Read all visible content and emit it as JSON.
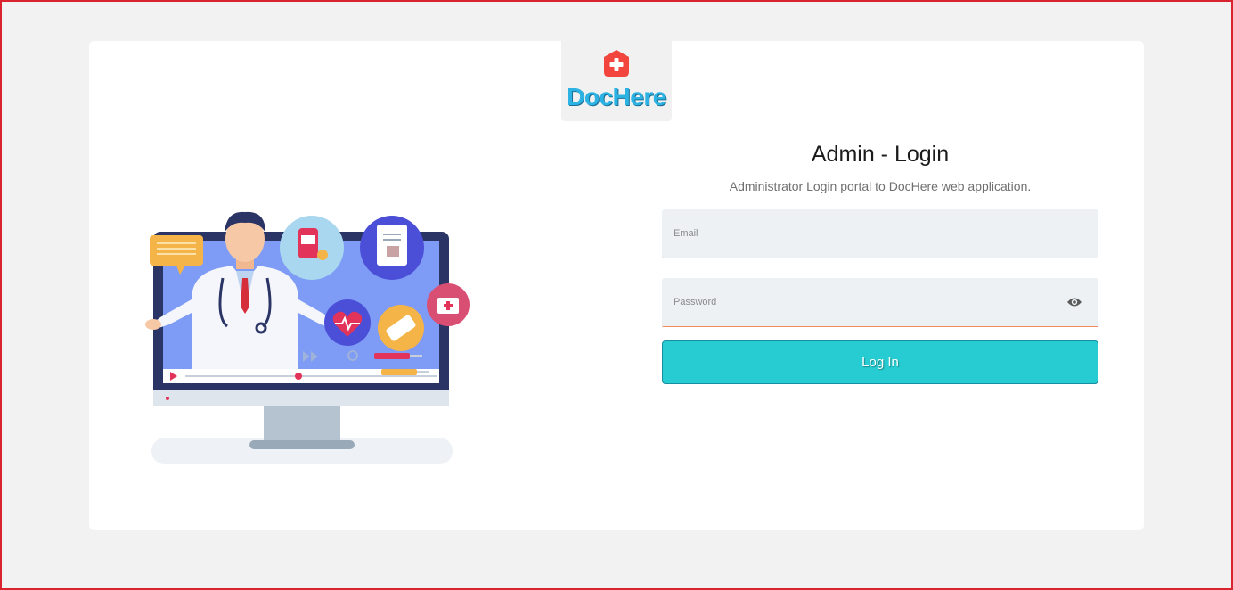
{
  "brand": {
    "name": "DocHere",
    "icon": "medical-cross-icon",
    "color": "#2cb3e3",
    "icon_color": "#f2453d"
  },
  "login": {
    "title": "Admin - Login",
    "subtitle": "Administrator Login portal to DocHere web application.",
    "email_placeholder": "Email",
    "email_value": "",
    "password_placeholder": "Password",
    "password_value": "",
    "password_toggle_icon": "eye-icon",
    "submit_label": "Log In",
    "accent_color": "#26ccd1",
    "field_border_color": "#f08a5d"
  },
  "illustration": {
    "subject": "doctor-on-monitor-illustration"
  },
  "colors": {
    "page_background": "#f2f2f2",
    "card_background": "#ffffff",
    "frame_border": "#d9232e"
  }
}
